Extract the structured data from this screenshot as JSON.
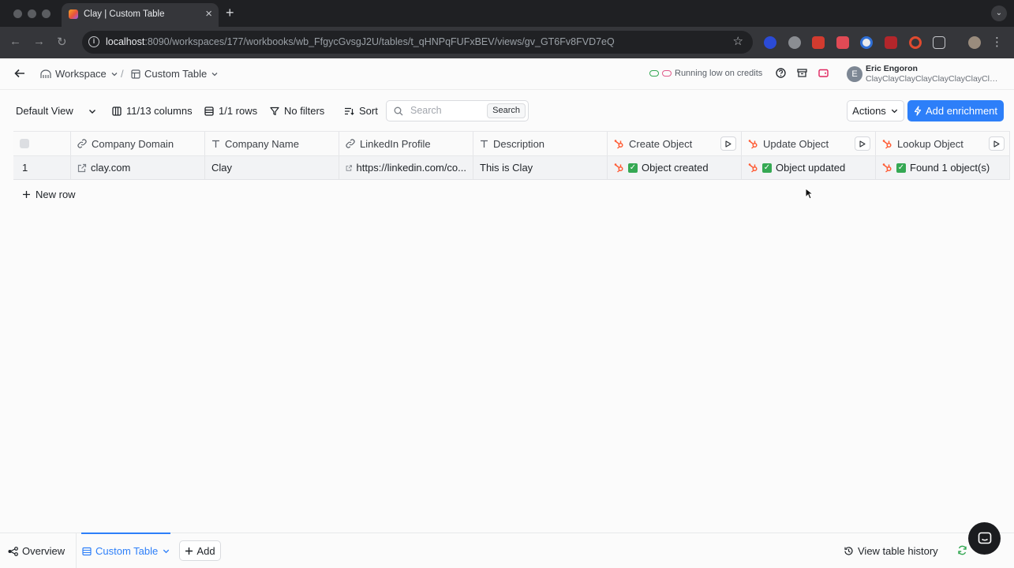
{
  "browser": {
    "tab_title": "Clay | Custom Table",
    "url_host": "localhost",
    "url_rest": ":8090/workspaces/177/workbooks/wb_FfgycGvsgJ2U/tables/t_qHNPqFUFxBEV/views/gv_GT6Fv8FVD7eQ"
  },
  "header": {
    "workspace": "Workspace",
    "separator": "/",
    "table_name": "Custom Table",
    "credits_text": "Running low on credits",
    "user_initial": "E",
    "user_name": "Eric Engoron",
    "user_org": "ClayClayClayClayClayClayClayClay"
  },
  "viewbar": {
    "view_name": "Default View",
    "columns": "11/13 columns",
    "rows": "1/1 rows",
    "filters": "No filters",
    "sort": "Sort",
    "search_placeholder": "Search",
    "search_button": "Search",
    "actions": "Actions",
    "add_enrichment": "Add enrichment"
  },
  "table": {
    "columns": [
      {
        "label": "Company Domain",
        "icon": "link-icon"
      },
      {
        "label": "Company Name",
        "icon": "text-type-icon"
      },
      {
        "label": "LinkedIn Profile",
        "icon": "link-icon"
      },
      {
        "label": "Description",
        "icon": "text-type-icon"
      },
      {
        "label": "Create Object",
        "icon": "hubspot-icon"
      },
      {
        "label": "Update Object",
        "icon": "hubspot-icon"
      },
      {
        "label": "Lookup Object",
        "icon": "hubspot-icon"
      }
    ],
    "rows": [
      {
        "index": "1",
        "company_domain": "clay.com",
        "company_name": "Clay",
        "linkedin": "https://linkedin.com/co...",
        "description": "This is Clay",
        "create_object": "Object created",
        "update_object": "Object updated",
        "lookup_object": "Found 1 object(s)"
      }
    ],
    "new_row": "New row"
  },
  "footer": {
    "overview": "Overview",
    "active_tab": "Custom Table",
    "add": "Add",
    "history": "View table history"
  },
  "colors": {
    "accent": "#2d7ff9",
    "hubspot": "#ff5c35",
    "success": "#35a853"
  }
}
